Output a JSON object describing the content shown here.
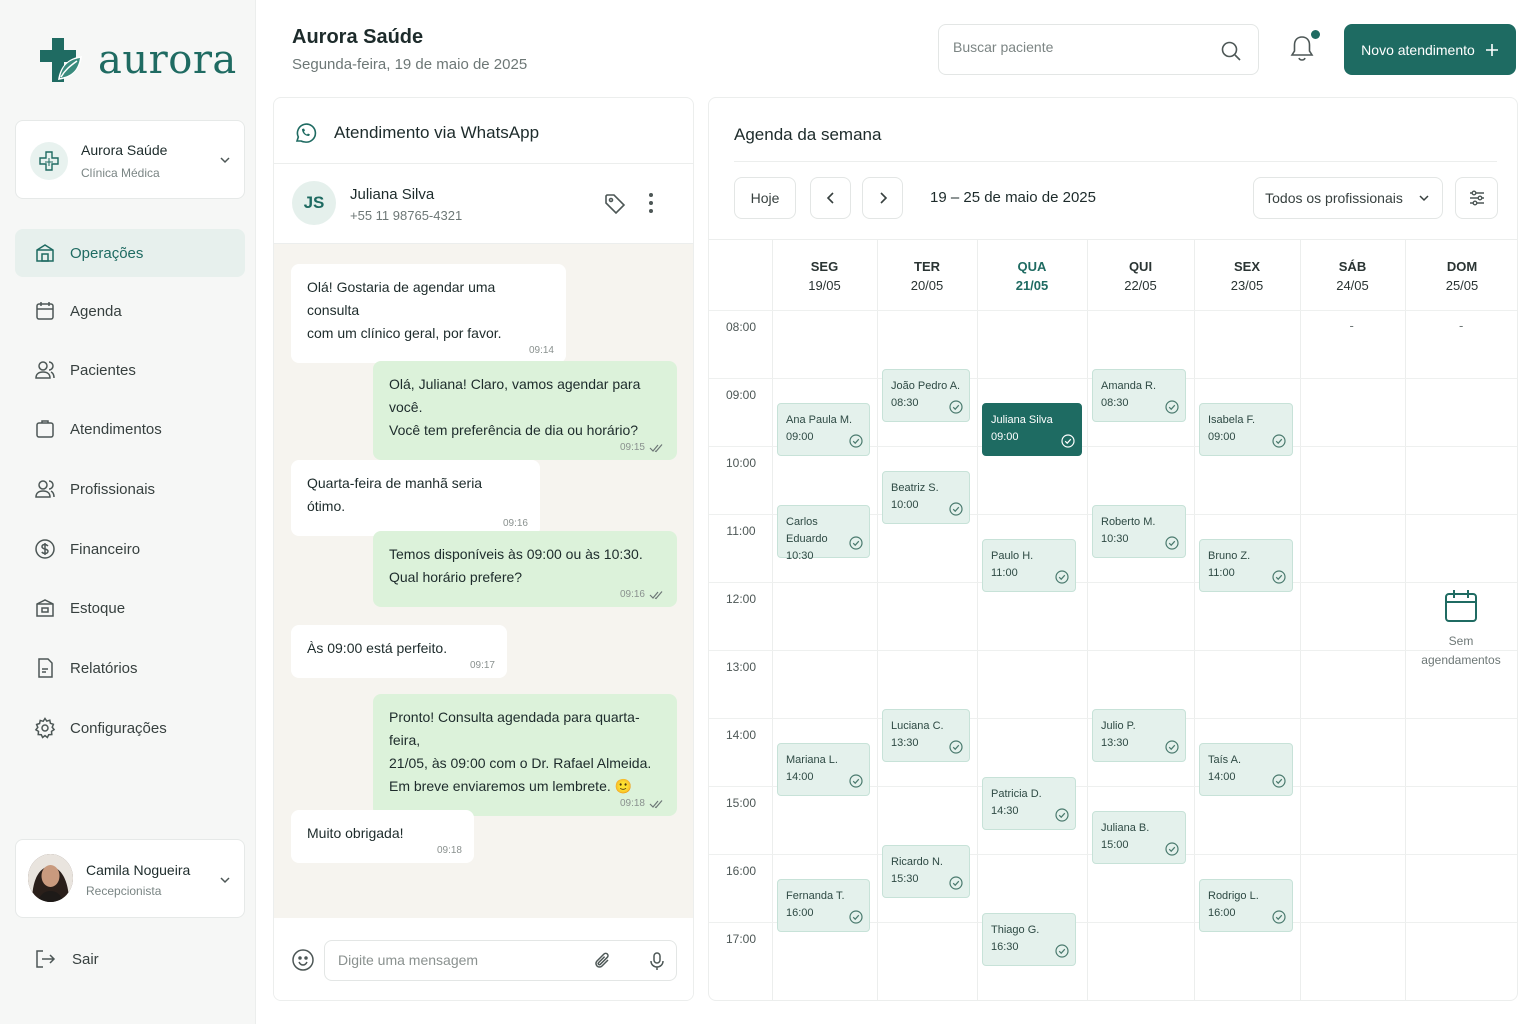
{
  "brand": {
    "name": "aurora",
    "color": "#1f6b62"
  },
  "clinic": {
    "name": "Aurora Saúde",
    "type": "Clínica Médica"
  },
  "nav": [
    {
      "label": "Operações",
      "icon": "store-icon",
      "active": true
    },
    {
      "label": "Agenda",
      "icon": "calendar-icon"
    },
    {
      "label": "Pacientes",
      "icon": "users-icon"
    },
    {
      "label": "Atendimentos",
      "icon": "clipboard-icon"
    },
    {
      "label": "Profissionais",
      "icon": "users-icon"
    },
    {
      "label": "Financeiro",
      "icon": "dollar-icon"
    },
    {
      "label": "Estoque",
      "icon": "box-icon"
    },
    {
      "label": "Relatórios",
      "icon": "report-icon"
    },
    {
      "label": "Configurações",
      "icon": "gear-icon"
    }
  ],
  "user": {
    "name": "Camila Nogueira",
    "role": "Recepcionista"
  },
  "logout_label": "Sair",
  "header": {
    "title": "Aurora Saúde",
    "date": "Segunda-feira, 19 de maio de 2025",
    "search_placeholder": "Buscar paciente",
    "new_button": "Novo atendimento"
  },
  "chat": {
    "title": "Atendimento via WhatsApp",
    "contact": {
      "initials": "JS",
      "name": "Juliana Silva",
      "phone": "+55 11 98765-4321"
    },
    "messages": [
      {
        "dir": "in",
        "lines": [
          "Olá! Gostaria de agendar uma consulta",
          "com um clínico geral, por favor."
        ],
        "time": "09:14"
      },
      {
        "dir": "out",
        "lines": [
          "Olá, Juliana! Claro, vamos agendar para você.",
          "Você tem preferência de dia ou horário?"
        ],
        "time": "09:15"
      },
      {
        "dir": "in",
        "lines": [
          "Quarta-feira de manhã seria ótimo."
        ],
        "time": "09:16"
      },
      {
        "dir": "out",
        "lines": [
          "Temos disponíveis às 09:00 ou às 10:30.",
          "Qual horário prefere?"
        ],
        "time": "09:16"
      },
      {
        "dir": "in",
        "lines": [
          "Às 09:00 está perfeito."
        ],
        "time": "09:17"
      },
      {
        "dir": "out",
        "lines": [
          "Pronto! Consulta agendada para quarta-feira,",
          "21/05, às 09:00 com o Dr. Rafael Almeida.",
          "Em breve enviaremos um lembrete. 🙂"
        ],
        "time": "09:18"
      },
      {
        "dir": "in",
        "lines": [
          "Muito obrigada!"
        ],
        "time": "09:18"
      }
    ],
    "input_placeholder": "Digite uma mensagem"
  },
  "agenda": {
    "title": "Agenda da semana",
    "today_label": "Hoje",
    "range": "19 – 25 de maio de 2025",
    "filter": "Todos os profissionais",
    "days": [
      {
        "name": "SEG",
        "date": "19/05"
      },
      {
        "name": "TER",
        "date": "20/05"
      },
      {
        "name": "QUA",
        "date": "21/05",
        "today": true
      },
      {
        "name": "QUI",
        "date": "22/05"
      },
      {
        "name": "SEX",
        "date": "23/05"
      },
      {
        "name": "SÁB",
        "date": "24/05"
      },
      {
        "name": "DOM",
        "date": "25/05"
      }
    ],
    "hours": [
      "08:00",
      "09:00",
      "10:00",
      "11:00",
      "12:00",
      "13:00",
      "14:00",
      "15:00",
      "16:00",
      "17:00"
    ],
    "day_dash": "-",
    "empty_text": [
      "Sem",
      "agendamentos"
    ],
    "appointments": [
      {
        "day": 0,
        "name": "Ana Paula M.",
        "time": "09:00"
      },
      {
        "day": 0,
        "name": "Carlos Eduardo",
        "time": "10:30"
      },
      {
        "day": 0,
        "name": "Mariana L.",
        "time": "14:00"
      },
      {
        "day": 0,
        "name": "Fernanda T.",
        "time": "16:00"
      },
      {
        "day": 1,
        "name": "João Pedro A.",
        "time": "08:30"
      },
      {
        "day": 1,
        "name": "Beatriz S.",
        "time": "10:00"
      },
      {
        "day": 1,
        "name": "Luciana C.",
        "time": "13:30"
      },
      {
        "day": 1,
        "name": "Ricardo N.",
        "time": "15:30"
      },
      {
        "day": 2,
        "name": "Juliana Silva",
        "time": "09:00",
        "selected": true
      },
      {
        "day": 2,
        "name": "Paulo H.",
        "time": "11:00"
      },
      {
        "day": 2,
        "name": "Patricia D.",
        "time": "14:30"
      },
      {
        "day": 2,
        "name": "Thiago G.",
        "time": "16:30"
      },
      {
        "day": 3,
        "name": "Amanda R.",
        "time": "08:30"
      },
      {
        "day": 3,
        "name": "Roberto M.",
        "time": "10:30"
      },
      {
        "day": 3,
        "name": "Julio P.",
        "time": "13:30"
      },
      {
        "day": 3,
        "name": "Juliana B.",
        "time": "15:00"
      },
      {
        "day": 4,
        "name": "Isabela F.",
        "time": "09:00"
      },
      {
        "day": 4,
        "name": "Bruno Z.",
        "time": "11:00"
      },
      {
        "day": 4,
        "name": "Taís A.",
        "time": "14:00"
      },
      {
        "day": 4,
        "name": "Rodrigo L.",
        "time": "16:00"
      }
    ]
  }
}
